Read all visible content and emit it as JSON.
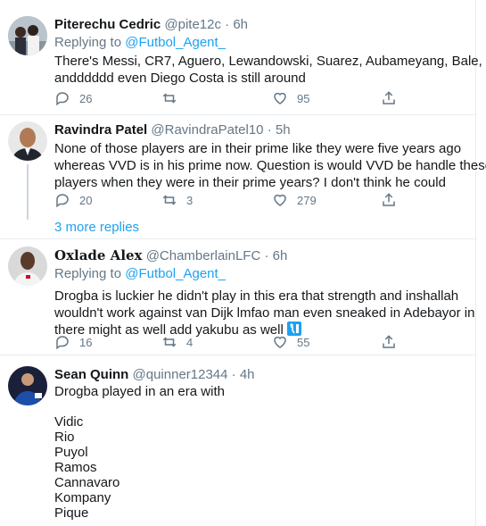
{
  "tweets": [
    {
      "name": "Piterechu Cedric",
      "handle": "@pite12c",
      "time": "6h",
      "replying_prefix": "Replying to",
      "replying_to": "@Futbol_Agent_",
      "lines": [
        "There's Messi, CR7, Aguero, Lewandowski, Suarez, Aubameyang, Bale,",
        "andddddd even Diego Costa is still around"
      ],
      "replies": "26",
      "retweets": "",
      "likes": "95"
    },
    {
      "name": "Ravindra Patel",
      "handle": "@RavindraPatel10",
      "time": "5h",
      "lines": [
        "None of  those players are in their prime like they were five years ago",
        "whereas VVD is in his prime now. Question is would VVD be handle these",
        "players when they were in their prime years? I don't think he could"
      ],
      "replies": "20",
      "retweets": "3",
      "likes": "279"
    },
    {
      "name": "Oxlade Alex",
      "handle": "@ChamberlainLFC",
      "time": "6h",
      "replying_prefix": "Replying to",
      "replying_to": "@Futbol_Agent_",
      "lines": [
        "Drogba is luckier he didn't play in this era that strength and inshallah",
        "wouldn't work against van Dijk lmfao man even sneaked in Adebayor in",
        "there might as well add yakubu as well"
      ],
      "replies": "16",
      "retweets": "4",
      "likes": "55"
    },
    {
      "name": "Sean Quinn",
      "handle": "@quinner12344",
      "time": "4h",
      "lines": [
        "Drogba played in an era with",
        "",
        "Vidic",
        "Rio",
        "Puyol",
        "Ramos",
        "Cannavaro",
        "Kompany",
        "Pique"
      ]
    }
  ],
  "more_replies": "3 more replies",
  "separator_dot": "·",
  "icons": {
    "reply": "reply-icon",
    "retweet": "retweet-icon",
    "like": "heart-icon",
    "share": "share-icon"
  },
  "colors": {
    "link": "#1da1f2",
    "muted": "#657786",
    "text": "#14171a",
    "divider": "#e6ecf0"
  }
}
